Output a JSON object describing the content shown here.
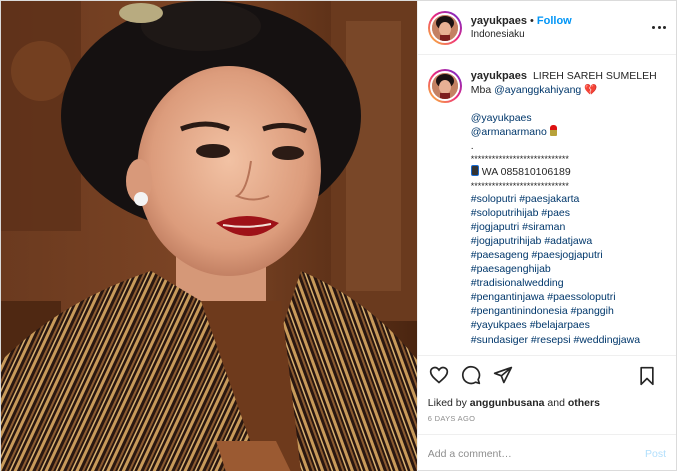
{
  "header": {
    "username": "yayukpaes",
    "separator": "•",
    "follow_label": "Follow",
    "location": "Indonesiaku"
  },
  "caption": {
    "username": "yayukpaes",
    "title": "LIREH SAREH SUMELEH",
    "mention_prefix": "Mba",
    "mention_main": "@ayanggkahiyang",
    "heart_emoji": "💔",
    "credits": [
      "@yayukpaes",
      "@armanarmano"
    ],
    "dot_line": ".",
    "stars_top": "****************************",
    "wa_text": "WA 085810106189",
    "stars_bottom": "****************************",
    "hashtags": [
      "#soloputri #paesjakarta",
      "#soloputrihijab #paes",
      "#jogjaputri #siraman",
      "#jogjaputrihijab #adatjawa",
      "#paesageng #paesjogjaputri",
      "#paesagenghijab",
      "#tradisionalwedding",
      "#pengantinjawa #paessoloputri",
      "#pengantinindonesia #panggih",
      "#yayukpaes #belajarpaes",
      "#sundasiger #resepsi #weddingjawa"
    ]
  },
  "icons": {
    "like": "heart-outline-icon",
    "comment": "comment-bubble-icon",
    "share": "paper-plane-icon",
    "save": "bookmark-icon",
    "more": "more-dots-icon"
  },
  "likes": {
    "prefix": "Liked by",
    "user": "anggunbusana",
    "suffix": "and",
    "others": "others"
  },
  "timestamp": "6 DAYS AGO",
  "comment_box": {
    "placeholder": "Add a comment…",
    "post_label": "Post"
  },
  "colors": {
    "accent": "#0095f6",
    "link": "#00376b",
    "muted": "#8e8e8e",
    "post_disabled": "#b2dffc"
  }
}
